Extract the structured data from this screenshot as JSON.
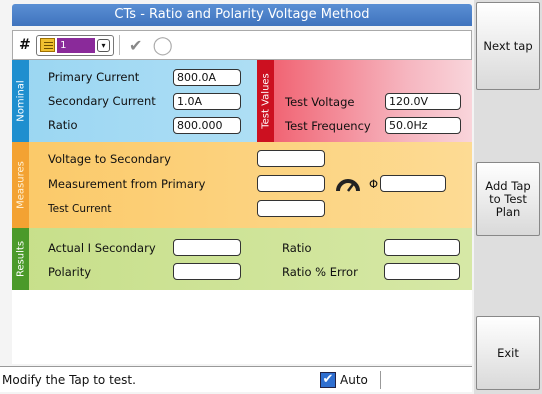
{
  "window": {
    "title": "CTs - Ratio and Polarity Voltage Method"
  },
  "toolbar": {
    "hash_label": "#",
    "tap_number": "1",
    "dropdown_arrow": "▾",
    "check_icon": "✔",
    "circle_icon": "◯"
  },
  "nominal": {
    "tab_label": "Nominal",
    "primary_current_label": "Primary Current",
    "primary_current_value": "800.0A",
    "secondary_current_label": "Secondary Current",
    "secondary_current_value": "1.0A",
    "ratio_label": "Ratio",
    "ratio_value": "800.000"
  },
  "test_values": {
    "tab_label": "Test Values",
    "test_voltage_label": "Test Voltage",
    "test_voltage_value": "120.0V",
    "test_frequency_label": "Test Frequency",
    "test_frequency_value": "50.0Hz"
  },
  "measures": {
    "tab_label": "Measures",
    "voltage_to_secondary_label": "Voltage to Secondary",
    "voltage_to_secondary_value": "",
    "measurement_from_primary_label": "Measurement from Primary",
    "measurement_from_primary_value": "",
    "phase_symbol": "Φ",
    "phase_value": "",
    "test_current_label": "Test Current",
    "test_current_value": ""
  },
  "results": {
    "tab_label": "Results",
    "actual_i_secondary_label": "Actual I Secondary",
    "actual_i_secondary_value": "",
    "polarity_label": "Polarity",
    "polarity_value": "",
    "ratio_label": "Ratio",
    "ratio_value": "",
    "ratio_error_label": "Ratio % Error",
    "ratio_error_value": ""
  },
  "status": {
    "message": "Modify the Tap to test.",
    "auto_label": "Auto",
    "auto_checked": true
  },
  "side_buttons": {
    "next_tap": "Next tap",
    "add_tap": "Add Tap to Test Plan",
    "exit": "Exit"
  },
  "colors": {
    "nominal": "#1f8fcf",
    "test_values": "#cc1020",
    "measures": "#f3a232",
    "results": "#4b9a2a",
    "title_bar": "#3f73bd"
  }
}
